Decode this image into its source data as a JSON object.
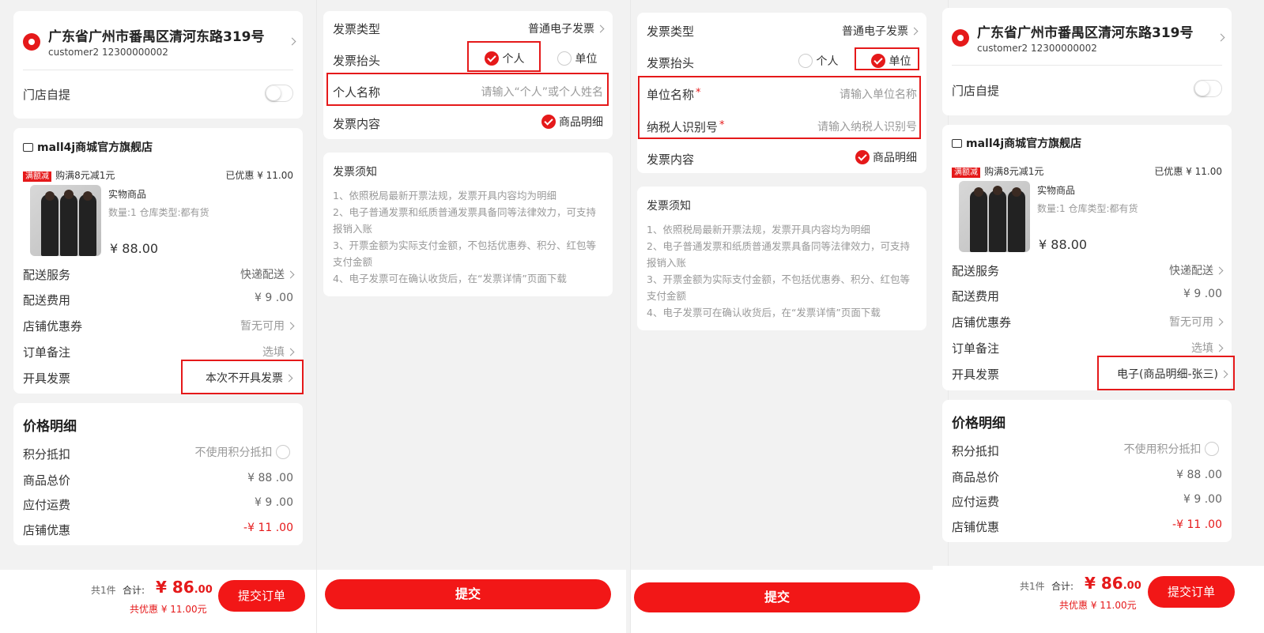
{
  "order": {
    "address": "广东省广州市番禺区清河东路319号",
    "customer": "customer2 12300000002",
    "pickup_label": "门店自提",
    "shop_name": "mall4j商城官方旗舰店",
    "promo_badge": "满额减",
    "promo_text": "购满8元减1元",
    "promo_saved": "已优惠 ¥ 11.00",
    "product_name": "实物商品",
    "product_meta": "数量:1   仓库类型:都有货",
    "product_price": "¥ 88.00",
    "rows": {
      "delivery_label": "配送服务",
      "delivery_value": "快递配送",
      "fee_label": "配送费用",
      "fee_value": "¥ 9 .00",
      "coupon_label": "店铺优惠券",
      "coupon_value": "暂无可用",
      "remark_label": "订单备注",
      "remark_value": "选填",
      "invoice_label": "开具发票"
    },
    "invoice_value_p1": "本次不开具发票",
    "invoice_value_p4": "电子(商品明细-张三)",
    "price_title": "价格明细",
    "points_label": "积分抵扣",
    "points_value": "不使用积分抵扣",
    "goods_total_label": "商品总价",
    "goods_total_value": "¥ 88 .00",
    "freight_label": "应付运费",
    "freight_value": "¥ 9 .00",
    "discount_label": "店铺优惠",
    "discount_value": "-¥ 11 .00",
    "bar": {
      "count": "共1件",
      "sum_label": "合计:",
      "total": "¥ 86",
      "total_cents": ".00",
      "saved": "共优惠 ¥ 11.00元",
      "submit": "提交订单"
    }
  },
  "invoice": {
    "type_label": "发票类型",
    "type_value": "普通电子发票",
    "header_label": "发票抬头",
    "opt_personal": "个人",
    "opt_company": "单位",
    "personal_name_label": "个人名称",
    "personal_name_placeholder": "请输入“个人”或个人姓名",
    "company_name_label": "单位名称",
    "company_name_placeholder": "请输入单位名称",
    "tax_id_label": "纳税人识别号",
    "tax_id_placeholder": "请输入纳税人识别号",
    "content_label": "发票内容",
    "content_value": "商品明细",
    "notice_title": "发票须知",
    "notice_1": "1、依照税局最新开票法规，发票开具内容均为明细",
    "notice_2": "2、电子普通发票和纸质普通发票具备同等法律效力，可支持报销入账",
    "notice_3": "3、开票金额为实际支付金额，不包括优惠券、积分、红包等支付金额",
    "notice_4": "4、电子发票可在确认收货后，在“发票详情”页面下载",
    "submit": "提交"
  },
  "colors": {
    "accent": "#e5191a",
    "button": "#f21717",
    "background": "#f2f2f2"
  }
}
